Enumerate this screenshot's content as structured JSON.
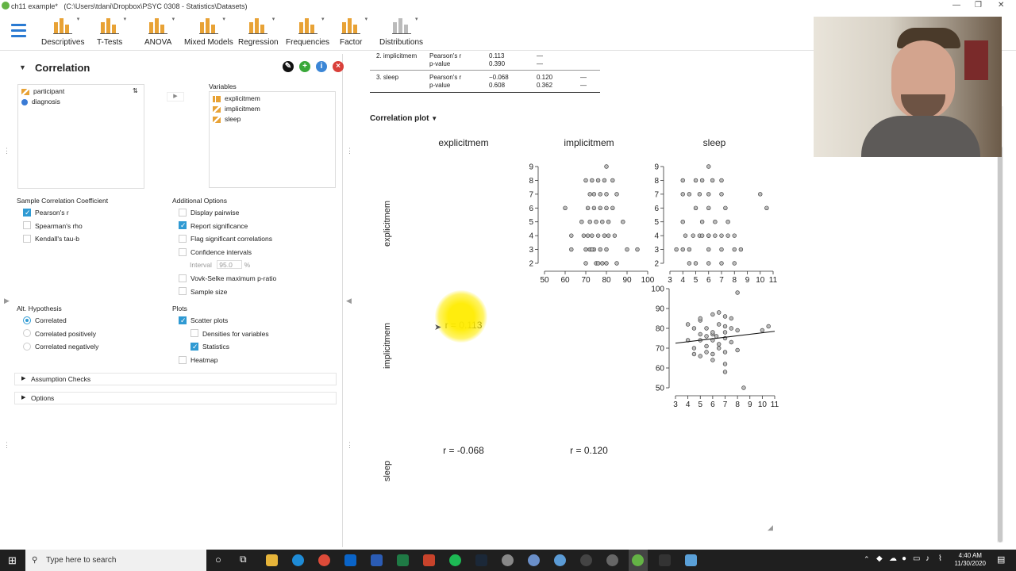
{
  "window": {
    "title": "ch11 example*",
    "path": "(C:\\Users\\tdani\\Dropbox\\PSYC 0308 - Statistics\\Datasets)"
  },
  "ribbon": {
    "items": [
      {
        "label": "Descriptives",
        "icon": "descriptives-icon"
      },
      {
        "label": "T-Tests",
        "icon": "ttests-icon"
      },
      {
        "label": "ANOVA",
        "icon": "anova-icon"
      },
      {
        "label": "Mixed Models",
        "icon": "mixed-models-icon"
      },
      {
        "label": "Regression",
        "icon": "regression-icon"
      },
      {
        "label": "Frequencies",
        "icon": "frequencies-icon"
      },
      {
        "label": "Factor",
        "icon": "factor-icon"
      },
      {
        "label": "Distributions",
        "icon": "distributions-icon"
      }
    ]
  },
  "analysis": {
    "title": "Correlation",
    "available_vars": [
      "participant",
      "diagnosis"
    ],
    "variables_label": "Variables",
    "selected_vars": [
      "explicitmem",
      "implicitmem",
      "sleep"
    ],
    "coef_section": "Sample Correlation Coefficient",
    "coef": [
      {
        "label": "Pearson's r",
        "checked": true
      },
      {
        "label": "Spearman's rho",
        "checked": false
      },
      {
        "label": "Kendall's tau-b",
        "checked": false
      }
    ],
    "additional_section": "Additional Options",
    "additional": [
      {
        "label": "Display pairwise",
        "checked": false
      },
      {
        "label": "Report significance",
        "checked": true
      },
      {
        "label": "Flag significant correlations",
        "checked": false
      },
      {
        "label": "Confidence intervals",
        "checked": false
      }
    ],
    "interval_label": "Interval",
    "interval_value": "95.0",
    "interval_unit": "%",
    "additional2": [
      {
        "label": "Vovk-Selke maximum p-ratio",
        "checked": false
      },
      {
        "label": "Sample size",
        "checked": false
      }
    ],
    "hyp_section": "Alt. Hypothesis",
    "hyp": [
      {
        "label": "Correlated",
        "checked": true
      },
      {
        "label": "Correlated positively",
        "checked": false
      },
      {
        "label": "Correlated negatively",
        "checked": false
      }
    ],
    "plots_section": "Plots",
    "plots": [
      {
        "label": "Scatter plots",
        "checked": true
      },
      {
        "label": "Densities for variables",
        "checked": false
      },
      {
        "label": "Statistics",
        "checked": true
      },
      {
        "label": "Heatmap",
        "checked": false
      }
    ],
    "assumption_checks": "Assumption Checks",
    "options": "Options"
  },
  "results_table": {
    "rows": [
      {
        "label": "2. implicitmem",
        "stat": "Pearson's r",
        "v1": "0.113",
        "v2": "—",
        "v3": ""
      },
      {
        "label": "",
        "stat": "p-value",
        "v1": "0.390",
        "v2": "—",
        "v3": ""
      },
      {
        "label": "3. sleep",
        "stat": "Pearson's r",
        "v1": "−0.068",
        "v2": "0.120",
        "v3": "—"
      },
      {
        "label": "",
        "stat": "p-value",
        "v1": "0.608",
        "v2": "0.362",
        "v3": "—"
      }
    ]
  },
  "plot_section_title": "Correlation plot",
  "chart_data": {
    "type": "scatter",
    "variables": [
      "explicitmem",
      "implicitmem",
      "sleep"
    ],
    "correlations": [
      {
        "pair": [
          "explicitmem",
          "implicitmem"
        ],
        "label": "r = 0.113"
      },
      {
        "pair": [
          "explicitmem",
          "sleep"
        ],
        "label": "r = -0.068"
      },
      {
        "pair": [
          "implicitmem",
          "sleep"
        ],
        "label": "r = 0.120"
      }
    ],
    "plots": [
      {
        "x_var": "implicitmem",
        "y_var": "explicitmem",
        "xlim": [
          50,
          100
        ],
        "ylim": [
          2,
          9
        ],
        "xticks": [
          "50",
          "60",
          "70",
          "80",
          "90",
          "100"
        ],
        "yticks": [
          "2",
          "3",
          "4",
          "5",
          "6",
          "7",
          "8",
          "9"
        ],
        "x": [
          80,
          70,
          73,
          76,
          79,
          83,
          60,
          72,
          74,
          77,
          80,
          85,
          71,
          74,
          77,
          80,
          83,
          68,
          72,
          75,
          78,
          81,
          88,
          63,
          69,
          71,
          73,
          76,
          79,
          81,
          84,
          72,
          74,
          77,
          80,
          90,
          63,
          70,
          75,
          78,
          95,
          70,
          73,
          76,
          80,
          85
        ],
        "y": [
          9,
          8,
          8,
          8,
          8,
          8,
          6,
          7,
          7,
          7,
          7,
          7,
          6,
          6,
          6,
          6,
          6,
          5,
          5,
          5,
          5,
          5,
          5,
          4,
          4,
          4,
          4,
          4,
          4,
          4,
          4,
          3,
          3,
          3,
          3,
          3,
          3,
          2,
          2,
          2,
          3,
          3,
          3,
          2,
          2,
          2
        ]
      },
      {
        "x_var": "sleep",
        "y_var": "explicitmem",
        "xlim": [
          3,
          11
        ],
        "ylim": [
          2,
          9
        ],
        "xticks": [
          "3",
          "4",
          "5",
          "6",
          "7",
          "8",
          "9",
          "10",
          "11"
        ],
        "yticks": [
          "2",
          "3",
          "4",
          "5",
          "6",
          "7",
          "8",
          "9"
        ],
        "x": [
          6,
          4,
          5,
          5.5,
          6.3,
          7,
          4,
          4.5,
          5.3,
          6,
          7,
          10,
          10.5,
          5,
          6,
          7.3,
          4,
          5.5,
          6.5,
          7.5,
          5.3,
          6,
          7,
          4.2,
          4.8,
          5.5,
          6,
          6.5,
          7.5,
          8,
          3.5,
          4,
          4.5,
          6,
          7,
          8,
          8.5,
          4.5,
          5,
          6,
          7,
          8
        ],
        "y": [
          9,
          8,
          8,
          8,
          8,
          8,
          7,
          7,
          7,
          7,
          7,
          7,
          6,
          6,
          6,
          6,
          5,
          5,
          5,
          5,
          4,
          4,
          4,
          4,
          4,
          4,
          4,
          4,
          4,
          4,
          3,
          3,
          3,
          3,
          3,
          3,
          3,
          2,
          2,
          2,
          2,
          2
        ]
      },
      {
        "x_var": "sleep",
        "y_var": "implicitmem",
        "xlim": [
          3,
          11
        ],
        "ylim": [
          50,
          100
        ],
        "xticks": [
          "3",
          "4",
          "5",
          "6",
          "7",
          "8",
          "9",
          "10",
          "11"
        ],
        "yticks": [
          "50",
          "60",
          "70",
          "80",
          "90",
          "100"
        ],
        "x": [
          8,
          4,
          5,
          6,
          7,
          4.5,
          5.5,
          6.5,
          7.5,
          5,
          6,
          7,
          8,
          4,
          5,
          6,
          7,
          5.5,
          6.5,
          7.5,
          4.5,
          5.5,
          6.5,
          5,
          6,
          7,
          8,
          6,
          7,
          10,
          10.5,
          6,
          7,
          6.5,
          5,
          7.5,
          5.5,
          6.3,
          8.5,
          7,
          4.5
        ],
        "y": [
          98,
          82,
          84,
          87,
          86,
          80,
          80,
          82,
          80,
          77,
          77,
          78,
          79,
          74,
          74,
          74,
          75,
          71,
          72,
          73,
          70,
          68,
          70,
          66,
          67,
          68,
          69,
          78,
          81,
          79,
          81,
          64,
          62,
          88,
          85,
          85,
          76,
          76,
          50,
          58,
          67
        ],
        "fit_line": {
          "x": [
            3,
            11
          ],
          "y": [
            72.5,
            78.5
          ]
        }
      }
    ]
  },
  "webcam": {
    "description": ""
  },
  "taskbar": {
    "search_placeholder": "Type here to search",
    "time": "4:40 AM",
    "date": "11/30/2020"
  }
}
